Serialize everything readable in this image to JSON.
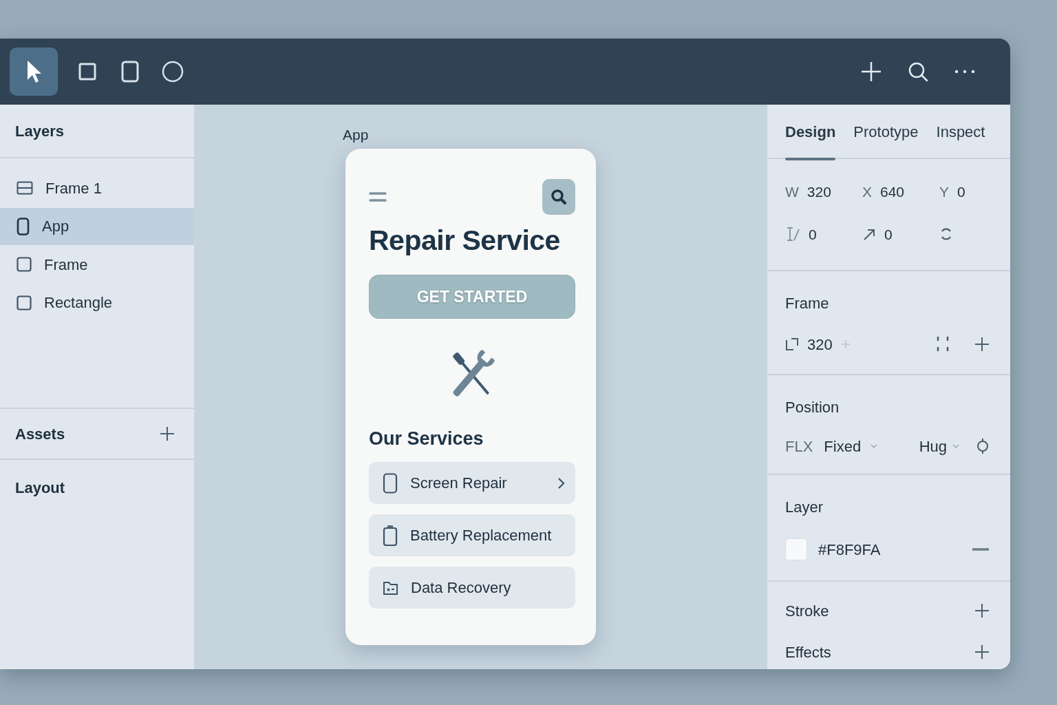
{
  "toolbar": {
    "tools": [
      {
        "kind": "pointer",
        "selected": true
      },
      {
        "kind": "square",
        "selected": false
      },
      {
        "kind": "device",
        "selected": false
      },
      {
        "kind": "circle",
        "selected": false
      }
    ],
    "actions": [
      {
        "kind": "plus"
      },
      {
        "kind": "search"
      },
      {
        "kind": "more"
      }
    ]
  },
  "layers_panel": {
    "title": "Layers",
    "items": [
      {
        "label": "Frame 1",
        "kind": "frame",
        "selected": false
      },
      {
        "label": "App",
        "kind": "device",
        "selected": true
      },
      {
        "label": "Frame",
        "kind": "square",
        "selected": false
      },
      {
        "label": "Rectangle",
        "kind": "square",
        "selected": false
      }
    ],
    "sections": [
      {
        "title": "Assets",
        "addable": true
      },
      {
        "title": "Layout",
        "addable": false
      }
    ]
  },
  "canvas": {
    "frame_label": "App",
    "app": {
      "title": "Repair Service",
      "button": "GET STARTED",
      "section_title": "Our Services",
      "services": [
        {
          "label": "Screen Repair",
          "kind": "phone",
          "chevron": true
        },
        {
          "label": "Battery Replacement",
          "kind": "battery",
          "chevron": false
        },
        {
          "label": "Data Recovery",
          "kind": "folder",
          "chevron": false
        }
      ]
    }
  },
  "inspector": {
    "tabs": [
      {
        "label": "Design",
        "selected": true
      },
      {
        "label": "Prototype",
        "selected": false
      },
      {
        "label": "Inspect",
        "selected": false
      }
    ],
    "transform": [
      {
        "label": "W",
        "value": "320"
      },
      {
        "label": "X",
        "value": "640"
      },
      {
        "label": "Y",
        "value": "0"
      },
      {
        "kind": "skew",
        "value": "0"
      },
      {
        "kind": "arrow",
        "value": "0"
      },
      {
        "kind": "rotate"
      }
    ],
    "frame": {
      "title": "Frame",
      "value": "320"
    },
    "position": {
      "title": "Position",
      "prefix": "FLX",
      "horizontal": "Fixed",
      "vertical": "Hug"
    },
    "layer": {
      "title": "Layer",
      "fill": "#F8F9FA"
    },
    "extras": [
      {
        "title": "Stroke"
      },
      {
        "title": "Effects"
      }
    ]
  }
}
